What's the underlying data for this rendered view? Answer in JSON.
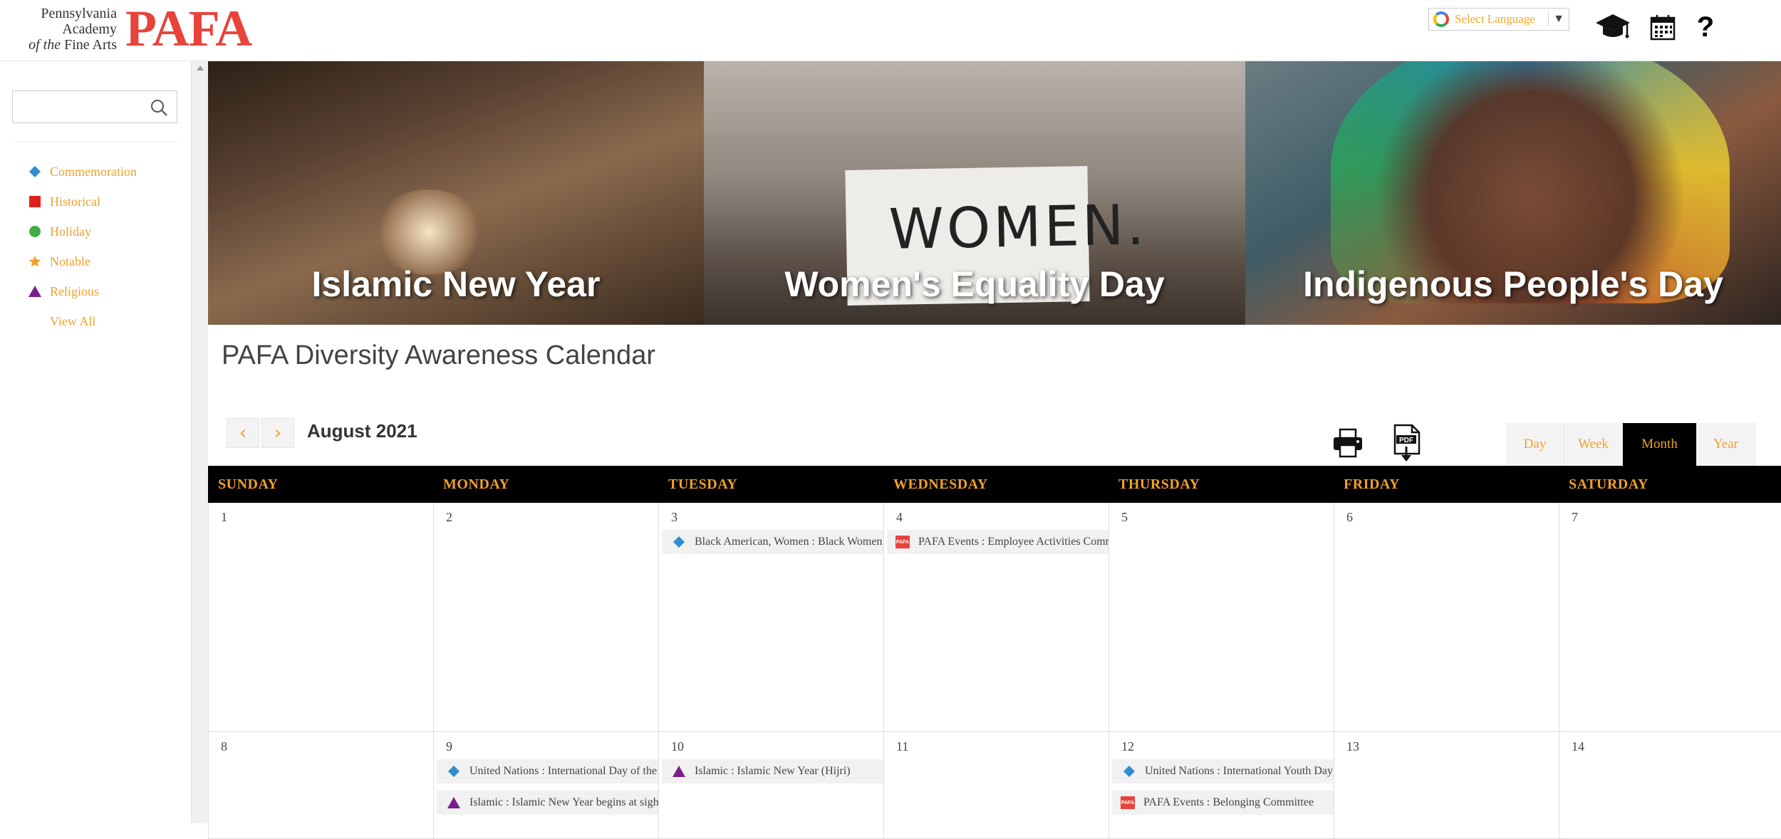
{
  "header": {
    "logo_line1": "Pennsylvania",
    "logo_line2": "Academy",
    "logo_line3_italic": "of the",
    "logo_line3_rest": "Fine Arts",
    "logo_mark": "PAFA",
    "language": "Select Language",
    "help_glyph": "?",
    "icons": [
      "graduation-cap-icon",
      "calendar-icon",
      "help-icon"
    ]
  },
  "sidebar": {
    "search_placeholder": "",
    "legend": [
      {
        "label": "Commemoration",
        "symbol": "diamond",
        "color": "#2e8fd0"
      },
      {
        "label": "Historical",
        "symbol": "square",
        "color": "#e0201a"
      },
      {
        "label": "Holiday",
        "symbol": "circle",
        "color": "#3fae49"
      },
      {
        "label": "Notable",
        "symbol": "star",
        "color": "#f0a02a"
      },
      {
        "label": "Religious",
        "symbol": "triangle",
        "color": "#7a1f8a"
      }
    ],
    "view_all": "View All"
  },
  "banner": {
    "panels": [
      {
        "title": "Islamic New Year"
      },
      {
        "title": "Women's Equality Day",
        "sign_text": "WOMEN."
      },
      {
        "title": "Indigenous People's Day"
      }
    ]
  },
  "page_title": "PAFA Diversity Awareness Calendar",
  "calendar": {
    "month_label": "August 2021",
    "prev_glyph": "‹",
    "next_glyph": "›",
    "tools": [
      "print-icon",
      "pdf-download-icon"
    ],
    "pdf_label": "PDF",
    "views": [
      "Day",
      "Week",
      "Month",
      "Year"
    ],
    "active_view": "Month",
    "weekdays": [
      "SUNDAY",
      "MONDAY",
      "TUESDAY",
      "WEDNESDAY",
      "THURSDAY",
      "FRIDAY",
      "SATURDAY"
    ],
    "weeks": [
      {
        "days": [
          {
            "num": "1",
            "events": []
          },
          {
            "num": "2",
            "events": []
          },
          {
            "num": "3",
            "events": [
              {
                "text": "Black American, Women : Black Women",
                "type": "commemoration"
              }
            ]
          },
          {
            "num": "4",
            "events": [
              {
                "text": "PAFA Events : Employee Activities Committee",
                "type": "pafa"
              }
            ]
          },
          {
            "num": "5",
            "events": []
          },
          {
            "num": "6",
            "events": []
          },
          {
            "num": "7",
            "events": []
          }
        ]
      },
      {
        "days": [
          {
            "num": "8",
            "events": []
          },
          {
            "num": "9",
            "events": [
              {
                "text": "United Nations : International Day of the",
                "type": "commemoration"
              },
              {
                "text": "Islamic : Islamic New Year begins at sighting",
                "type": "religious"
              }
            ]
          },
          {
            "num": "10",
            "events": [
              {
                "text": "Islamic : Islamic New Year (Hijri)",
                "type": "religious"
              }
            ]
          },
          {
            "num": "11",
            "events": []
          },
          {
            "num": "12",
            "events": [
              {
                "text": "United Nations : International Youth Day",
                "type": "commemoration"
              },
              {
                "text": "PAFA Events : Belonging Committee",
                "type": "pafa"
              }
            ]
          },
          {
            "num": "13",
            "events": []
          },
          {
            "num": "14",
            "events": []
          }
        ]
      }
    ]
  },
  "colors": {
    "accent": "#f0a02a",
    "brand_red": "#e8433b",
    "header_bg": "#000000"
  }
}
